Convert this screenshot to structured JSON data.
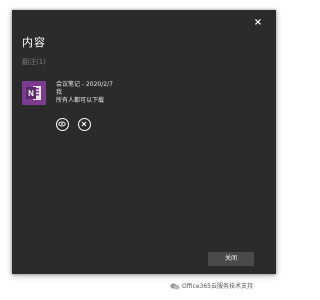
{
  "dialog": {
    "title": "内容",
    "close_glyph": "×",
    "section_label": "翻注(1)",
    "close_button_label": "关闭"
  },
  "item": {
    "icon": "onenote-file-icon",
    "icon_color": "#7b3b8e",
    "title_line": "会议笔记 - 2020/2/7",
    "author": "我",
    "permission": "所有人都可以下载",
    "actions": [
      {
        "name": "view",
        "icon": "eye-icon"
      },
      {
        "name": "delete",
        "icon": "close-icon"
      }
    ]
  },
  "watermark": {
    "text": "Office365云服务技术支持"
  }
}
